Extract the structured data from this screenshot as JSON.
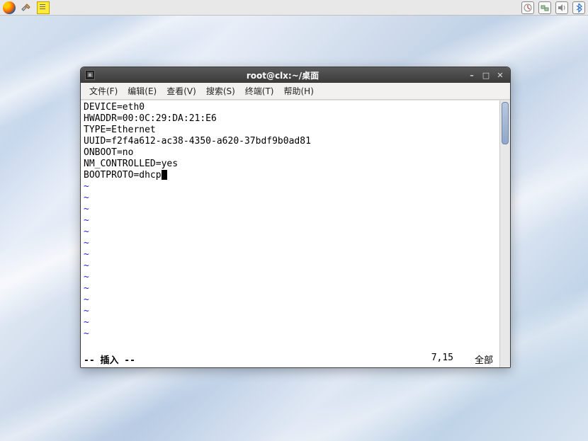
{
  "panel": {
    "left_icons": [
      "firefox",
      "tools",
      "notepad"
    ],
    "right_icons": [
      "monitor",
      "network",
      "volume",
      "bluetooth"
    ]
  },
  "window": {
    "title": "root@clx:~/桌面",
    "menus": {
      "file": "文件(F)",
      "edit": "编辑(E)",
      "view": "查看(V)",
      "search": "搜索(S)",
      "terminal": "终端(T)",
      "help": "帮助(H)"
    }
  },
  "terminal": {
    "lines": [
      "DEVICE=eth0",
      "HWADDR=00:0C:29:DA:21:E6",
      "TYPE=Ethernet",
      "UUID=f2f4a612-ac38-4350-a620-37bdf9b0ad81",
      "ONBOOT=no",
      "NM_CONTROLLED=yes",
      "BOOTPROTO=dhcp"
    ],
    "status": {
      "mode": "-- 插入 --",
      "position": "7,15",
      "percent": "全部"
    }
  }
}
